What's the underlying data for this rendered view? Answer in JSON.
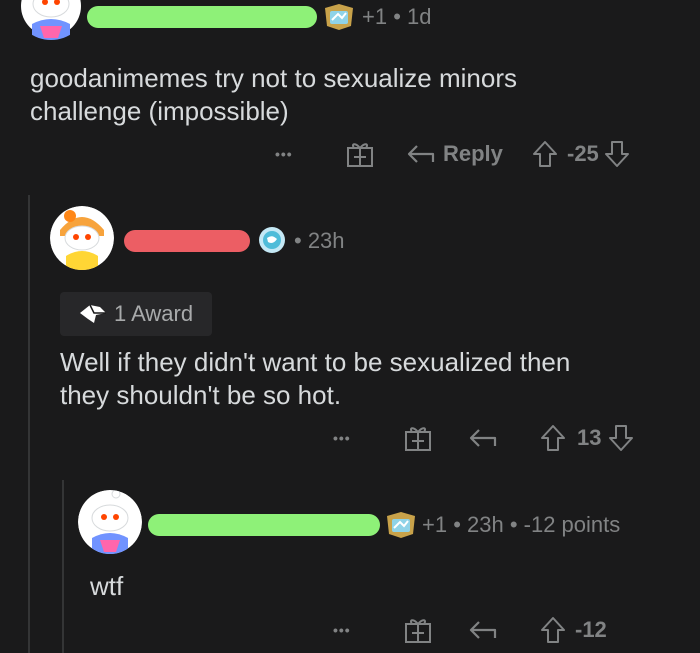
{
  "colors": {
    "background": "#1a1a1b",
    "text": "#d7dadc",
    "meta": "#818384",
    "username_green": "#8ef178",
    "username_red": "#ec5e64",
    "thread_line": "#343536"
  },
  "comments": [
    {
      "meta": "+1 • 1d",
      "flair_icon": "chest-badge-icon",
      "body_line1": "goodanimemes try not to sexualize minors",
      "body_line2": "challenge (impossible)",
      "actions": {
        "more": "•••",
        "reply": "Reply",
        "score": "-25"
      }
    },
    {
      "meta": "• 23h",
      "flair_icon": "globe-badge-icon",
      "award_label": "1 Award",
      "body_line1": "Well if they didn't want to be sexualized then",
      "body_line2": "they shouldn't be so hot.",
      "actions": {
        "more": "•••",
        "score": "13"
      }
    },
    {
      "meta": "+1 • 23h • -12 points",
      "flair_icon": "chest-badge-icon",
      "body": "wtf",
      "actions": {
        "more": "•••",
        "score": "-12"
      }
    }
  ]
}
